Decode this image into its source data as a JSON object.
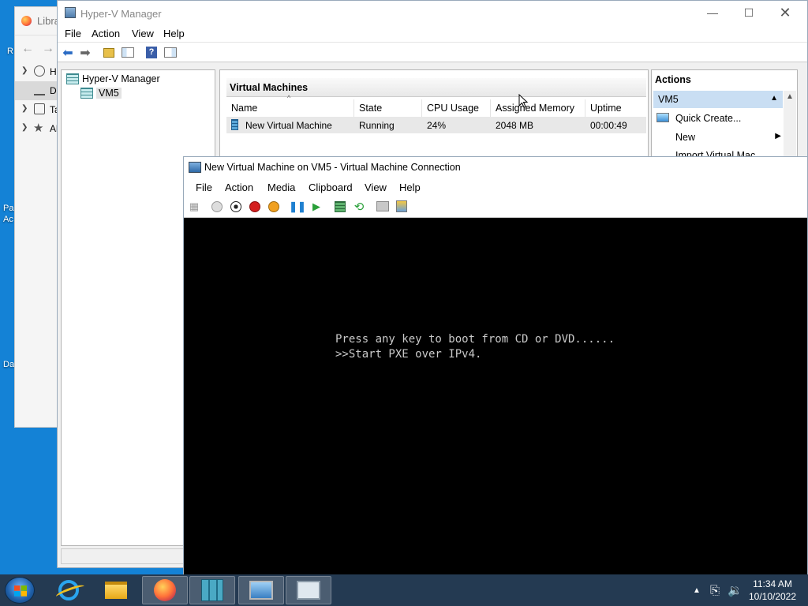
{
  "desktop": {
    "labels": [
      "R",
      "Pa",
      "Ac",
      "Da"
    ]
  },
  "library": {
    "title": "Libra",
    "items": [
      {
        "label": "H",
        "icon": "clock-icon"
      },
      {
        "label": "D",
        "icon": "download-icon"
      },
      {
        "label": "Ta",
        "icon": "tag-icon"
      },
      {
        "label": "Al",
        "icon": "star-icon"
      }
    ]
  },
  "hyperv": {
    "title": "Hyper-V Manager",
    "menu": [
      "File",
      "Action",
      "View",
      "Help"
    ],
    "tree": {
      "root": "Hyper-V Manager",
      "child": "VM5"
    },
    "vm_panel": {
      "header": "Virtual Machines",
      "columns": [
        "Name",
        "State",
        "CPU Usage",
        "Assigned Memory",
        "Uptime"
      ],
      "rows": [
        {
          "name": "New Virtual Machine",
          "state": "Running",
          "cpu": "24%",
          "memory": "2048 MB",
          "uptime": "00:00:49"
        }
      ]
    },
    "actions": {
      "title": "Actions",
      "group": "VM5",
      "items": [
        "Quick Create...",
        "New",
        "Import Virtual Mac"
      ]
    }
  },
  "vmconnect": {
    "title": "New Virtual Machine on VM5 - Virtual Machine Connection",
    "menu": [
      "File",
      "Action",
      "Media",
      "Clipboard",
      "View",
      "Help"
    ],
    "console_lines": [
      "Press any key to boot from CD or DVD......",
      ">>Start PXE over IPv4."
    ]
  },
  "taskbar": {
    "time": "11:34 AM",
    "date": "10/10/2022"
  },
  "colors": {
    "desktop": "#1482d6",
    "taskbar": "#243a52",
    "selection": "#c9def3",
    "console_bg": "#000000",
    "console_fg": "#c9c9c9"
  }
}
